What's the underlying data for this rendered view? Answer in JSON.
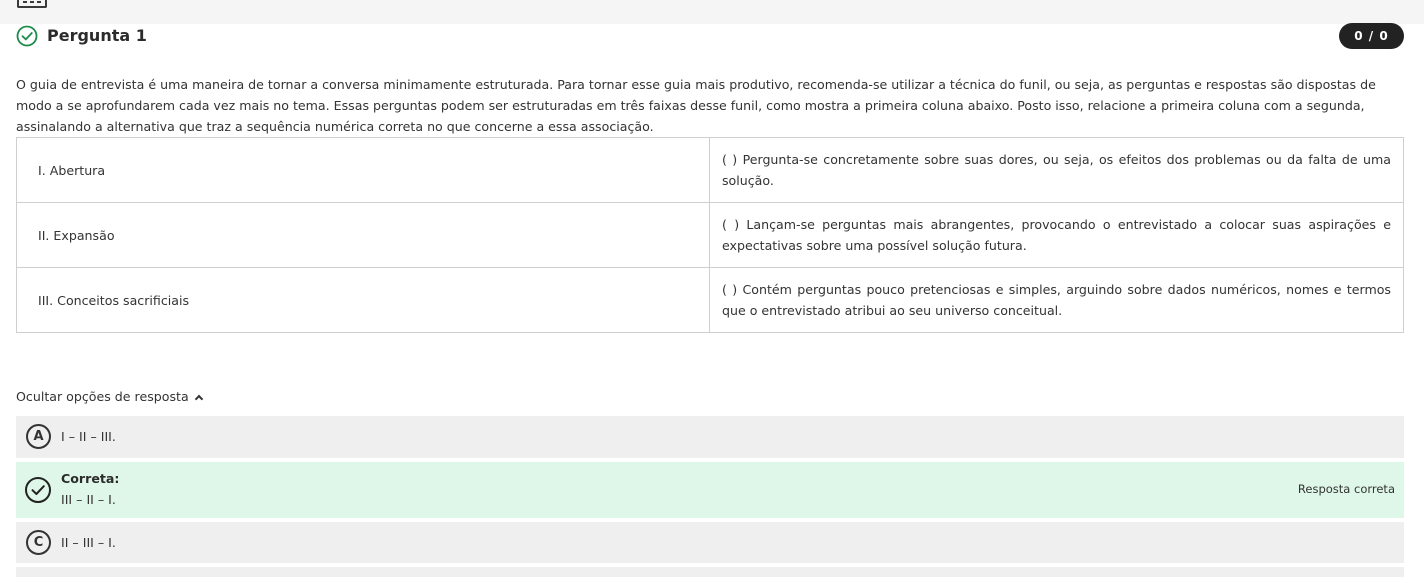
{
  "question": {
    "title": "Pergunta 1",
    "score": "0 / 0",
    "statement": "O guia de entrevista é uma maneira de tornar a conversa minimamente estruturada. Para tornar esse guia mais produtivo, recomenda-se utilizar a técnica do funil, ou seja, as perguntas e respostas são dispostas de modo a se aprofundarem cada vez mais no tema. Essas perguntas podem ser estruturadas em três faixas desse funil, como mostra a primeira coluna abaixo. Posto isso, relacione a primeira coluna com a segunda, assinalando a alternativa que traz a sequência numérica correta no que concerne a essa associação."
  },
  "table": {
    "rows": [
      {
        "left": "I. Abertura",
        "right": "(   )    Pergunta-se concretamente sobre suas dores, ou seja, os efeitos dos problemas ou da falta de uma solução."
      },
      {
        "left": "II. Expansão",
        "right": "(   )    Lançam-se perguntas mais abrangentes, provocando o entrevistado a colocar suas aspirações e expectativas sobre uma possível solução futura."
      },
      {
        "left": "III. Conceitos sacrificiais",
        "right": "(   )    Contém perguntas pouco pretenciosas e simples, arguindo sobre dados numéricos, nomes e termos que o entrevistado atribui ao seu universo conceitual."
      }
    ]
  },
  "answers": {
    "toggle_label": "Ocultar opções de resposta",
    "option_a": {
      "letter": "A",
      "text": "I – II – III."
    },
    "option_b": {
      "label": "Correta:",
      "text": "III – II – I.",
      "tag": "Resposta correta"
    },
    "option_c": {
      "letter": "C",
      "text": "II – III – I."
    }
  },
  "colors": {
    "correct_bg": "#dff7e8",
    "option_bg": "#efefef",
    "check_green": "#1e8a4c",
    "badge_bg": "#222222"
  }
}
